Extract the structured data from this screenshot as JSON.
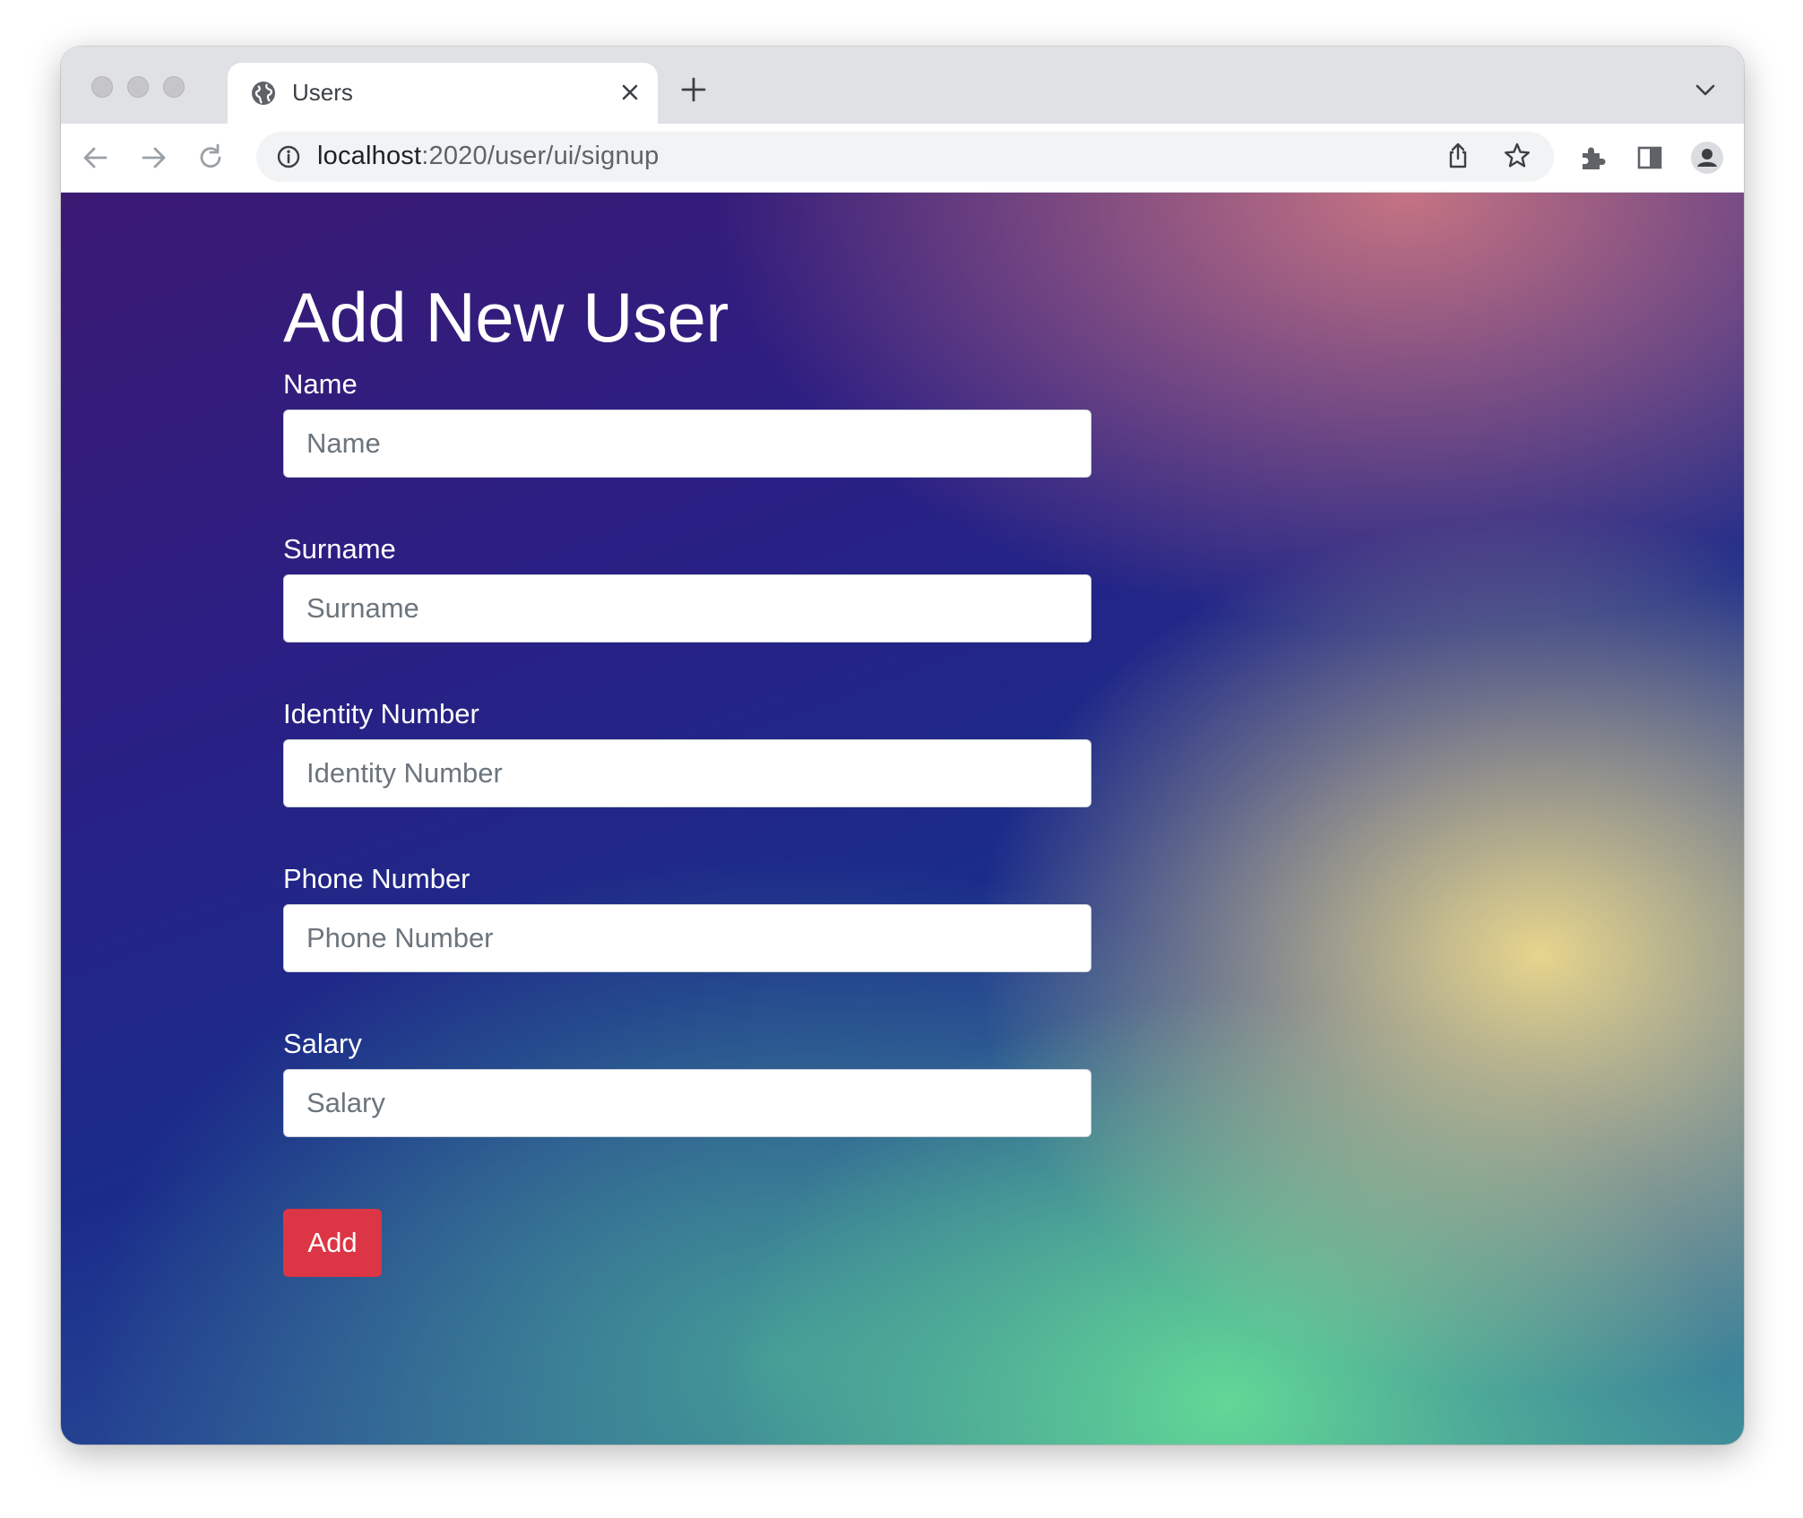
{
  "browser": {
    "tab": {
      "title": "Users",
      "icon": "globe-icon"
    },
    "address": {
      "host": "localhost",
      "path": ":2020/user/ui/signup"
    },
    "icons": {
      "back": "back-arrow-icon",
      "forward": "forward-arrow-icon",
      "reload": "reload-icon",
      "info": "info-icon",
      "share": "share-icon",
      "bookmark": "star-icon",
      "extensions": "puzzle-icon",
      "sidepanel": "side-panel-icon",
      "profile": "profile-icon",
      "menu": "kebab-menu-icon"
    }
  },
  "page": {
    "title": "Add New User",
    "fields": [
      {
        "label": "Name",
        "placeholder": "Name",
        "value": ""
      },
      {
        "label": "Surname",
        "placeholder": "Surname",
        "value": ""
      },
      {
        "label": "Identity Number",
        "placeholder": "Identity Number",
        "value": ""
      },
      {
        "label": "Phone Number",
        "placeholder": "Phone Number",
        "value": ""
      },
      {
        "label": "Salary",
        "placeholder": "Salary",
        "value": ""
      }
    ],
    "submit_label": "Add"
  },
  "colors": {
    "button": "#dc3545",
    "text_on_background": "#ffffff"
  }
}
